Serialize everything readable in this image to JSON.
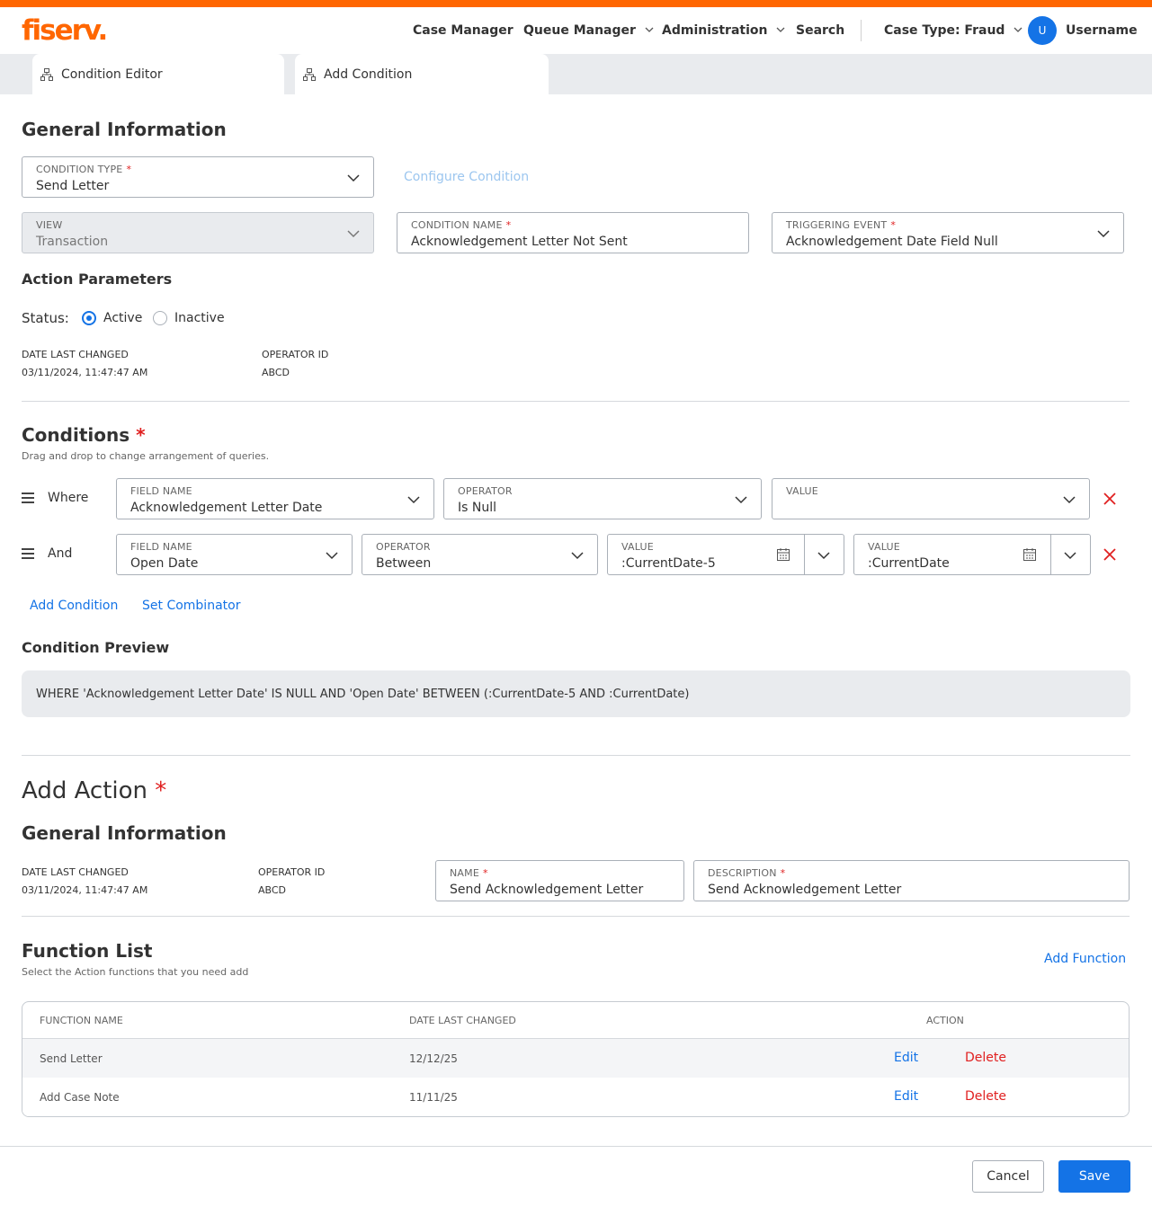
{
  "brand": {
    "logo_text": "fiserv.",
    "accent_color": "#ff6600",
    "primary_color": "#1473e6"
  },
  "nav": {
    "case_manager": "Case Manager",
    "queue_manager": "Queue Manager",
    "administration": "Administration",
    "search": "Search",
    "case_type": "Case Type: Fraud",
    "avatar_initial": "U",
    "username": "Username"
  },
  "tabs": [
    {
      "label": "Condition Editor",
      "icon": "network-icon"
    },
    {
      "label": "Add Condition",
      "icon": "network-icon"
    }
  ],
  "general": {
    "title": "General Information",
    "condition_type": {
      "label": "Condition Type",
      "value": "Send Letter",
      "required": "*"
    },
    "configure_link": "Configure Condition",
    "view": {
      "label": "View",
      "value": "Transaction"
    },
    "condition_name": {
      "label": "Condition Name",
      "value": "Acknowledgement Letter Not Sent",
      "required": "*"
    },
    "triggering_event": {
      "label": "Triggering Event",
      "value": "Acknowledgement Date Field Null",
      "required": "*"
    }
  },
  "action_params": {
    "title": "Action Parameters",
    "status_label": "Status:",
    "active": "Active",
    "inactive": "Inactive",
    "selected": "Active",
    "date_label": "Date Last Changed",
    "date_value": "03/11/2024, 11:47:47 AM",
    "operator_label": "Operator ID",
    "operator_value": "ABCD"
  },
  "conditions": {
    "title": "Conditions",
    "required": "*",
    "hint": "Drag and drop to change arrangement of queries.",
    "rows": [
      {
        "combinator": "Where",
        "field_label": "Field Name",
        "field_value": "Acknowledgement Letter Date",
        "operator_label": "Operator",
        "operator_value": "Is Null",
        "value_label": "Value",
        "value_value": ""
      },
      {
        "combinator": "And",
        "field_label": "Field Name",
        "field_value": "Open Date",
        "operator_label": "Operator",
        "operator_value": "Between",
        "value1_label": "Value",
        "value1_value": ":CurrentDate-5",
        "value2_label": "Value",
        "value2_value": ":CurrentDate"
      }
    ],
    "add_condition": "Add Condition",
    "set_combinator": "Set Combinator",
    "preview_title": "Condition Preview",
    "preview_text": "WHERE 'Acknowledgement Letter Date' IS NULL AND 'Open Date' BETWEEN (:CurrentDate-5 AND :CurrentDate)"
  },
  "add_action": {
    "title": "Add Action",
    "required": "*",
    "general_title": "General Information",
    "date_label": "Date Last Changed",
    "date_value": "03/11/2024, 11:47:47 AM",
    "operator_label": "Operator ID",
    "operator_value": "ABCD",
    "name": {
      "label": "Name",
      "value": "Send Acknowledgement Letter",
      "required": "*"
    },
    "description": {
      "label": "Description",
      "value": "Send Acknowledgement Letter",
      "required": "*"
    }
  },
  "functions": {
    "title": "Function List",
    "hint": "Select the Action functions that you need add",
    "add_function": "Add Function",
    "columns": [
      "Function Name",
      "Date Last Changed",
      "Action"
    ],
    "rows": [
      {
        "name": "Send Letter",
        "date": "12/12/25",
        "edit": "Edit",
        "delete": "Delete"
      },
      {
        "name": "Add Case Note",
        "date": "11/11/25",
        "edit": "Edit",
        "delete": "Delete"
      }
    ]
  },
  "footer": {
    "cancel": "Cancel",
    "save": "Save"
  }
}
